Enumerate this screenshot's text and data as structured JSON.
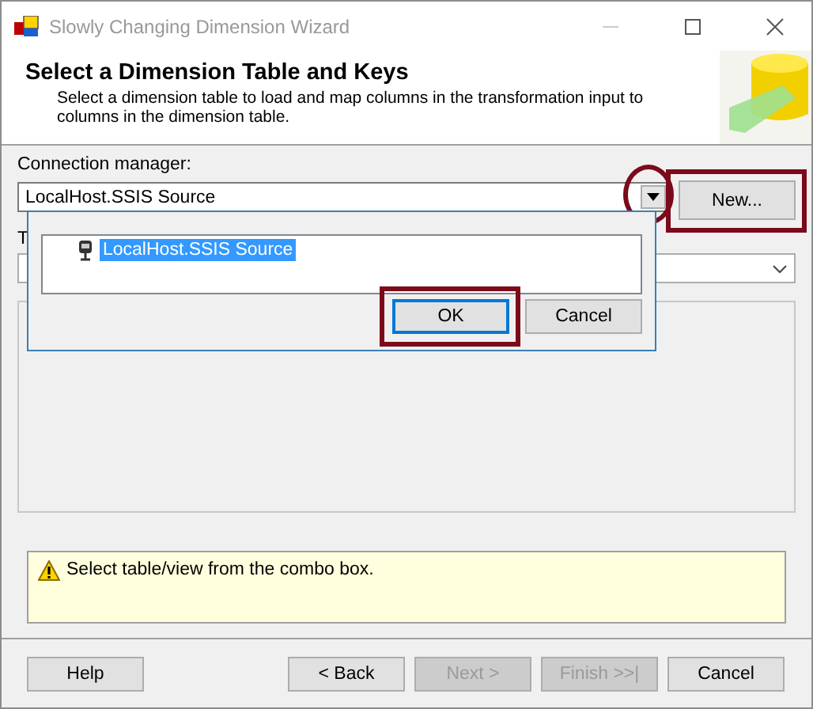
{
  "window": {
    "title": "Slowly Changing Dimension Wizard"
  },
  "header": {
    "title": "Select a Dimension Table and Keys",
    "description": "Select a dimension table to load and map columns in the transformation input to columns in the dimension table."
  },
  "connection_manager": {
    "label": "Connection manager:",
    "value": "LocalHost.SSIS Source",
    "dropdown_circled": true,
    "new_button": {
      "label": "New...",
      "framed": true
    }
  },
  "table_view": {
    "label": "T"
  },
  "popup": {
    "items": [
      {
        "label": "LocalHost.SSIS Source",
        "selected": true
      }
    ],
    "buttons": [
      {
        "label": "OK",
        "default": true,
        "framed": true
      },
      {
        "label": "Cancel",
        "default": false,
        "framed": false
      }
    ]
  },
  "message": {
    "kind": "warning",
    "text": "Select table/view from the combo box."
  },
  "buttons": [
    {
      "label": "Help",
      "disabled": false
    },
    {
      "label": "< Back",
      "disabled": false
    },
    {
      "label": "Next >",
      "disabled": true
    },
    {
      "label": "Finish >>|",
      "disabled": true
    },
    {
      "label": "Cancel",
      "disabled": false
    }
  ]
}
